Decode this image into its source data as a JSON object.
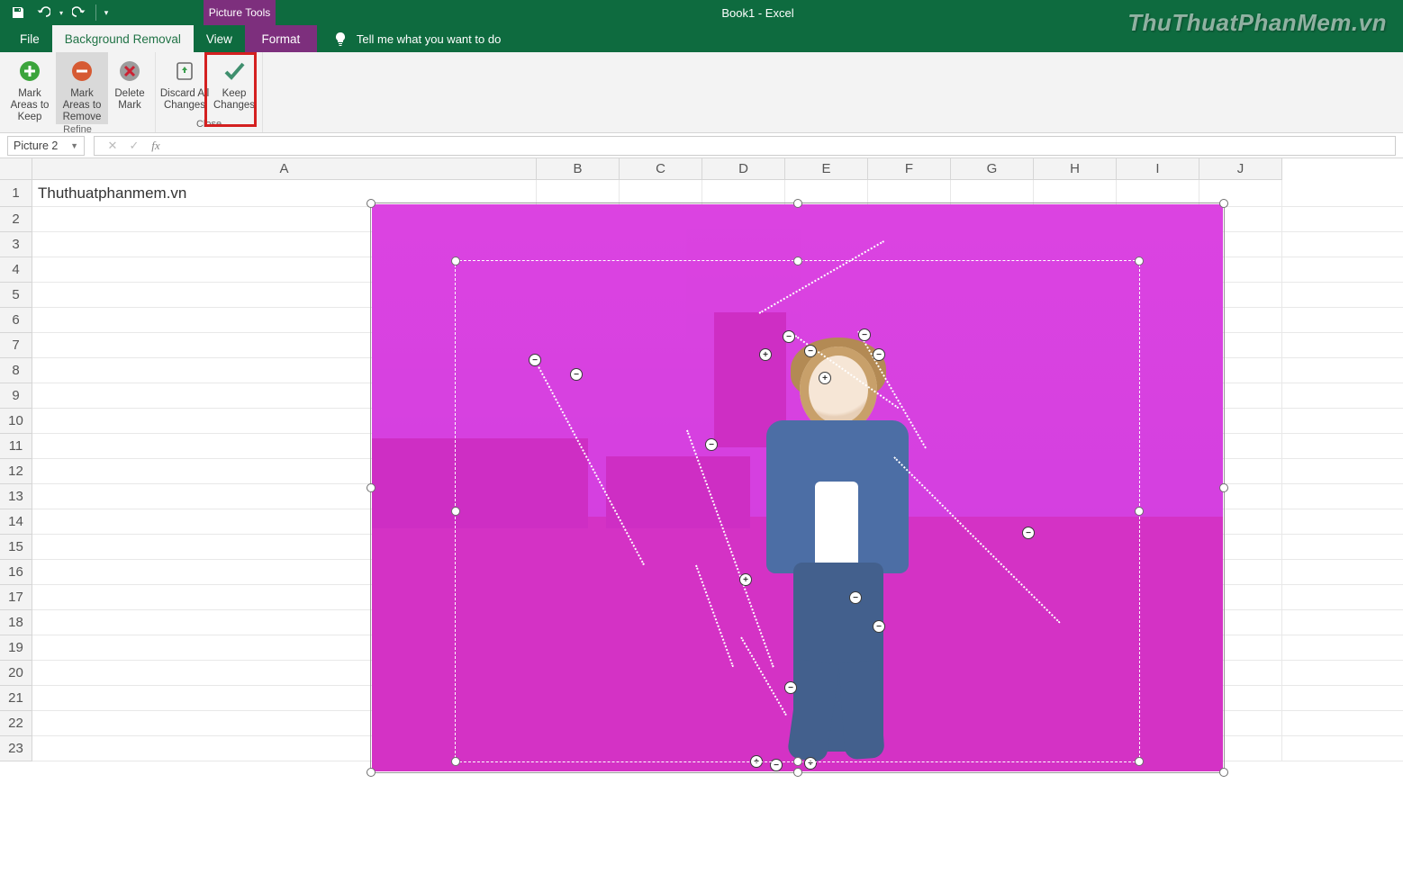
{
  "app": {
    "title": "Book1 - Excel",
    "context_tool_label": "Picture Tools",
    "watermark": "ThuThuatPhanMem.vn"
  },
  "qat": {
    "save": "save",
    "undo": "undo",
    "redo": "redo",
    "customize": "customize"
  },
  "tabs": {
    "file": "File",
    "bg_removal": "Background Removal",
    "view": "View",
    "format": "Format",
    "tellme": "Tell me what you want to do"
  },
  "ribbon": {
    "mark_keep": "Mark Areas to Keep",
    "mark_remove": "Mark Areas to Remove",
    "delete_mark": "Delete Mark",
    "discard": "Discard All Changes",
    "keep": "Keep Changes",
    "group_refine": "Refine",
    "group_close": "Close"
  },
  "fbar": {
    "namebox": "Picture 2",
    "formula": ""
  },
  "grid": {
    "columns": [
      "A",
      "B",
      "C",
      "D",
      "E",
      "F",
      "G",
      "H",
      "I",
      "J"
    ],
    "rows": [
      "1",
      "2",
      "3",
      "4",
      "5",
      "6",
      "7",
      "8",
      "9",
      "10",
      "11",
      "12",
      "13",
      "14",
      "15",
      "16",
      "17",
      "18",
      "19",
      "20",
      "21",
      "22",
      "23"
    ],
    "cell_A1": "Thuthuatphanmem.vn"
  }
}
